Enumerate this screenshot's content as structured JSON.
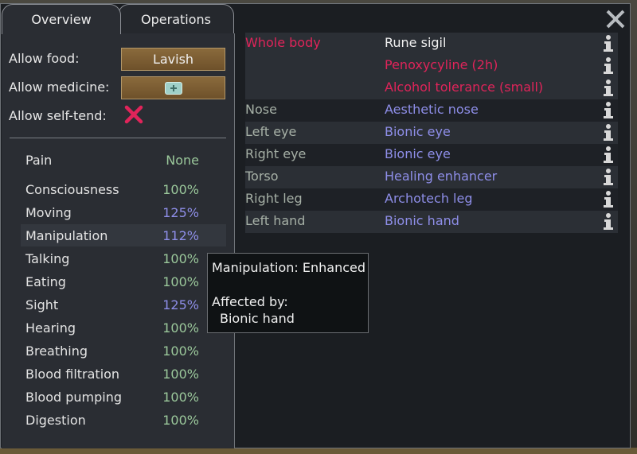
{
  "tabs": [
    {
      "label": "Overview",
      "active": true
    },
    {
      "label": "Operations",
      "active": false
    }
  ],
  "settings": {
    "food_label": "Allow food:",
    "food_value": "Lavish",
    "medicine_label": "Allow medicine:",
    "medicine_icon": "medicine-kit-icon",
    "selftend_label": "Allow self-tend:",
    "selftend_icon": "cross-icon"
  },
  "pain": {
    "label": "Pain",
    "value": "None"
  },
  "capacities": [
    {
      "label": "Consciousness",
      "value": "100%",
      "color": "#9bc89b"
    },
    {
      "label": "Moving",
      "value": "125%",
      "color": "#8e8ee8"
    },
    {
      "label": "Manipulation",
      "value": "112%",
      "color": "#8e8ee8"
    },
    {
      "label": "Talking",
      "value": "100%",
      "color": "#9bc89b"
    },
    {
      "label": "Eating",
      "value": "100%",
      "color": "#9bc89b"
    },
    {
      "label": "Sight",
      "value": "125%",
      "color": "#8e8ee8"
    },
    {
      "label": "Hearing",
      "value": "100%",
      "color": "#9bc89b"
    },
    {
      "label": "Breathing",
      "value": "100%",
      "color": "#9bc89b"
    },
    {
      "label": "Blood filtration",
      "value": "100%",
      "color": "#9bc89b"
    },
    {
      "label": "Blood pumping",
      "value": "100%",
      "color": "#9bc89b"
    },
    {
      "label": "Digestion",
      "value": "100%",
      "color": "#9bc89b"
    }
  ],
  "health_parts": [
    {
      "part": "Whole body",
      "hediffs": [
        "Rune sigil",
        "Penoxycyline (2h)",
        "Alcohol tolerance (small)"
      ]
    },
    {
      "part": "Nose",
      "hediffs": [
        "Aesthetic nose"
      ]
    },
    {
      "part": "Left eye",
      "hediffs": [
        "Bionic eye"
      ]
    },
    {
      "part": "Right eye",
      "hediffs": [
        "Bionic eye"
      ]
    },
    {
      "part": "Torso",
      "hediffs": [
        "Healing enhancer"
      ]
    },
    {
      "part": "Right leg",
      "hediffs": [
        "Archotech leg"
      ]
    },
    {
      "part": "Left hand",
      "hediffs": [
        "Bionic hand"
      ]
    }
  ],
  "tooltip": {
    "title": "Manipulation: Enhanced",
    "subtitle": "Affected by:",
    "item": "Bionic hand"
  },
  "colors": {
    "red": "#e0245a",
    "blue": "#8e8ee8",
    "green": "#9bc89b"
  }
}
